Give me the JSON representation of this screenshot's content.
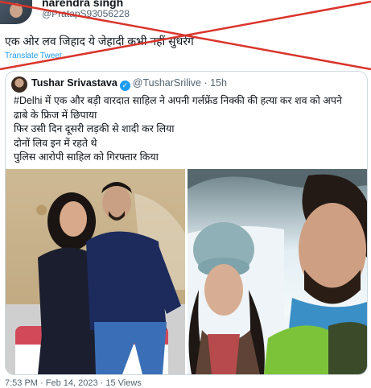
{
  "author": {
    "name": "narendra singh",
    "handle": "@PratapS93056228"
  },
  "tweet": {
    "text": "एक ओर लव जिहाद ये जेहादी कभी नहीं सुधरेंगे",
    "translate_label": "Translate Tweet"
  },
  "quoted": {
    "name": "Tushar Srivastava",
    "handle": "@TusharSrilive",
    "time": "· 15h",
    "lines": [
      "#Delhi में एक और बड़ी वारदात साहिल ने अपनी गर्लफ्रेंड निक्की की हत्या कर शव को अपने",
      "ढाबे के फ्रिज में छिपाया",
      "फिर उसी दिन दूसरी लड़की से शादी कर लिया",
      "दोनों लिव इन में रहते थे",
      "पुलिस आरोपी साहिल को गिरफ्तार किया"
    ]
  },
  "footer": {
    "text": "7:53 PM · Feb 14, 2023 · 15 Views"
  },
  "colors": {
    "accent": "#1d9bf0",
    "cross": "#d9342b"
  }
}
